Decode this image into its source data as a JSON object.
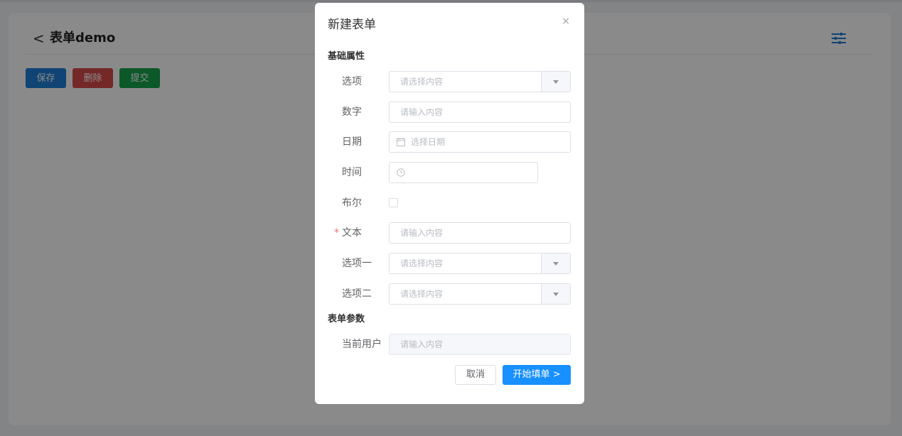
{
  "page": {
    "title": "表单demo",
    "back_glyph": "<",
    "buttons": {
      "save": "保存",
      "delete": "删除",
      "submit": "提交"
    }
  },
  "modal": {
    "title": "新建表单",
    "close_glyph": "×",
    "sections": {
      "basic": "基础属性",
      "params": "表单参数"
    },
    "fields": {
      "option": {
        "label": "选项",
        "placeholder": "请选择内容"
      },
      "number": {
        "label": "数字",
        "placeholder": "请输入内容"
      },
      "date": {
        "label": "日期",
        "placeholder": "选择日期"
      },
      "time": {
        "label": "时间",
        "placeholder": ""
      },
      "bool": {
        "label": "布尔"
      },
      "text": {
        "label": "文本",
        "placeholder": "请输入内容",
        "required_mark": "*"
      },
      "option1": {
        "label": "选项一",
        "placeholder": "请选择内容"
      },
      "option2": {
        "label": "选项二",
        "placeholder": "请选择内容"
      },
      "user": {
        "label": "当前用户",
        "placeholder": "请输入内容"
      }
    },
    "footer": {
      "cancel": "取消",
      "start": "开始填单 >"
    }
  },
  "colors": {
    "primary": "#1890ff",
    "save": "#1e7ed6",
    "delete": "#d94b4b",
    "submit": "#17a34a",
    "required": "#f56c6c"
  },
  "icons": {
    "settings": "sliders-icon",
    "date": "calendar-icon",
    "time": "clock-icon"
  }
}
